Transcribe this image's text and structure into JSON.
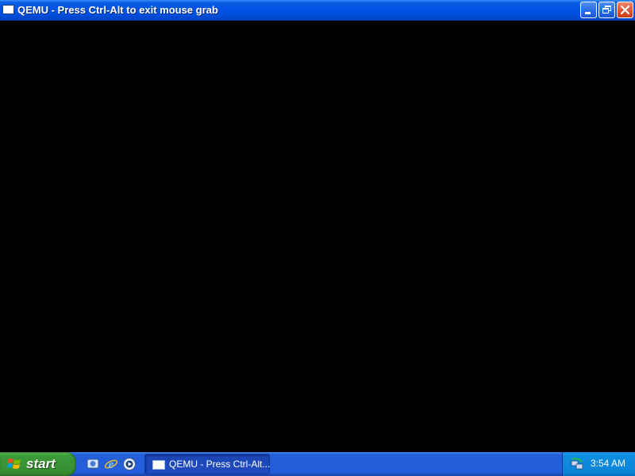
{
  "window": {
    "title": "QEMU - Press Ctrl-Alt to exit mouse grab",
    "app_icon": "qemu-window-icon",
    "buttons": {
      "minimize_icon": "minimize-icon",
      "restore_icon": "restore-icon",
      "close_icon": "close-icon"
    },
    "colors": {
      "titlebar": "#0054e3",
      "content": "#000000",
      "close_button": "#e0542e"
    }
  },
  "taskbar": {
    "start_label": "start",
    "start_icon": "windows-logo-icon",
    "quick_launch": [
      {
        "icon": "show-desktop-icon"
      },
      {
        "icon": "internet-explorer-icon"
      },
      {
        "icon": "media-player-icon"
      }
    ],
    "tasks": [
      {
        "label": "QEMU - Press Ctrl-Alt...",
        "icon": "qemu-window-icon"
      }
    ],
    "tray": {
      "icon": "network-icon",
      "clock": "3:54 AM"
    },
    "colors": {
      "bar": "#245edb",
      "start": "#388e33",
      "tray": "#0b84d8"
    }
  }
}
